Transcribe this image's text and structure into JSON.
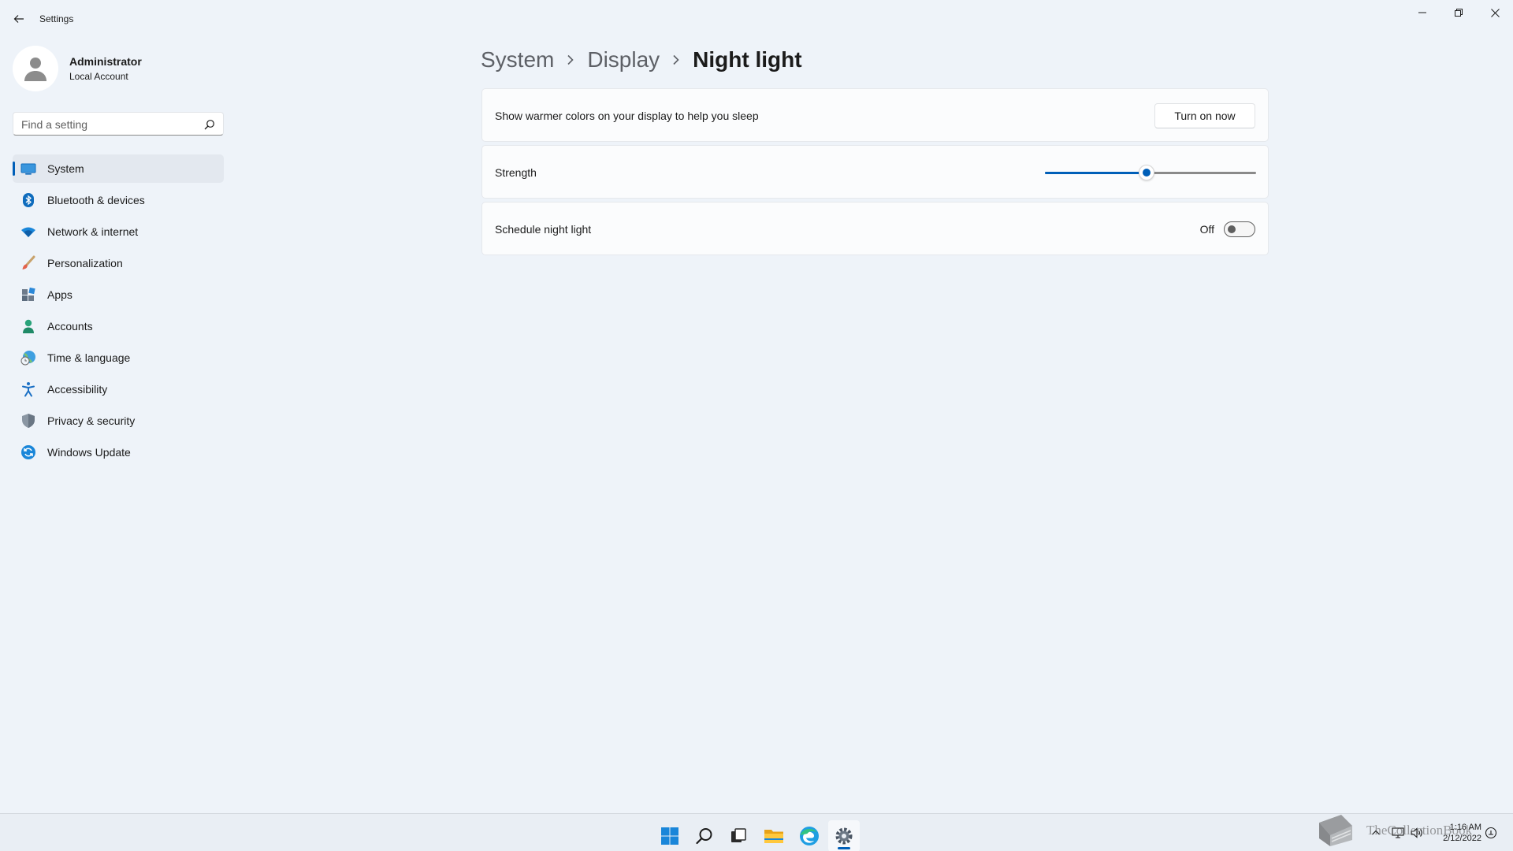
{
  "window": {
    "title": "Settings"
  },
  "profile": {
    "name": "Administrator",
    "account_type": "Local Account"
  },
  "search": {
    "placeholder": "Find a setting"
  },
  "sidebar": {
    "items": [
      {
        "label": "System",
        "icon": "monitor-icon",
        "active": true
      },
      {
        "label": "Bluetooth & devices",
        "icon": "bluetooth-icon"
      },
      {
        "label": "Network & internet",
        "icon": "wifi-icon"
      },
      {
        "label": "Personalization",
        "icon": "brush-icon"
      },
      {
        "label": "Apps",
        "icon": "apps-icon"
      },
      {
        "label": "Accounts",
        "icon": "person-icon"
      },
      {
        "label": "Time & language",
        "icon": "globe-clock-icon"
      },
      {
        "label": "Accessibility",
        "icon": "accessibility-icon"
      },
      {
        "label": "Privacy & security",
        "icon": "shield-icon"
      },
      {
        "label": "Windows Update",
        "icon": "update-icon"
      }
    ]
  },
  "breadcrumb": {
    "items": [
      "System",
      "Display",
      "Night light"
    ]
  },
  "night_light": {
    "description": "Show warmer colors on your display to help you sleep",
    "turn_on_label": "Turn on now",
    "strength_label": "Strength",
    "strength_value": 0.48,
    "schedule_label": "Schedule night light",
    "schedule_state": "Off"
  },
  "taskbar": {
    "apps": [
      "start-icon",
      "search-icon",
      "task-view-icon",
      "file-explorer-icon",
      "edge-icon",
      "settings-icon"
    ],
    "tray": [
      "chevron-up-icon",
      "network-icon",
      "volume-icon"
    ],
    "time": "1:16 AM",
    "date": "2/12/2022"
  },
  "watermark": {
    "text": "TheCollectionBook"
  },
  "colors": {
    "accent": "#005fb8",
    "background": "#eef3f9",
    "card": "#fbfcfd"
  }
}
